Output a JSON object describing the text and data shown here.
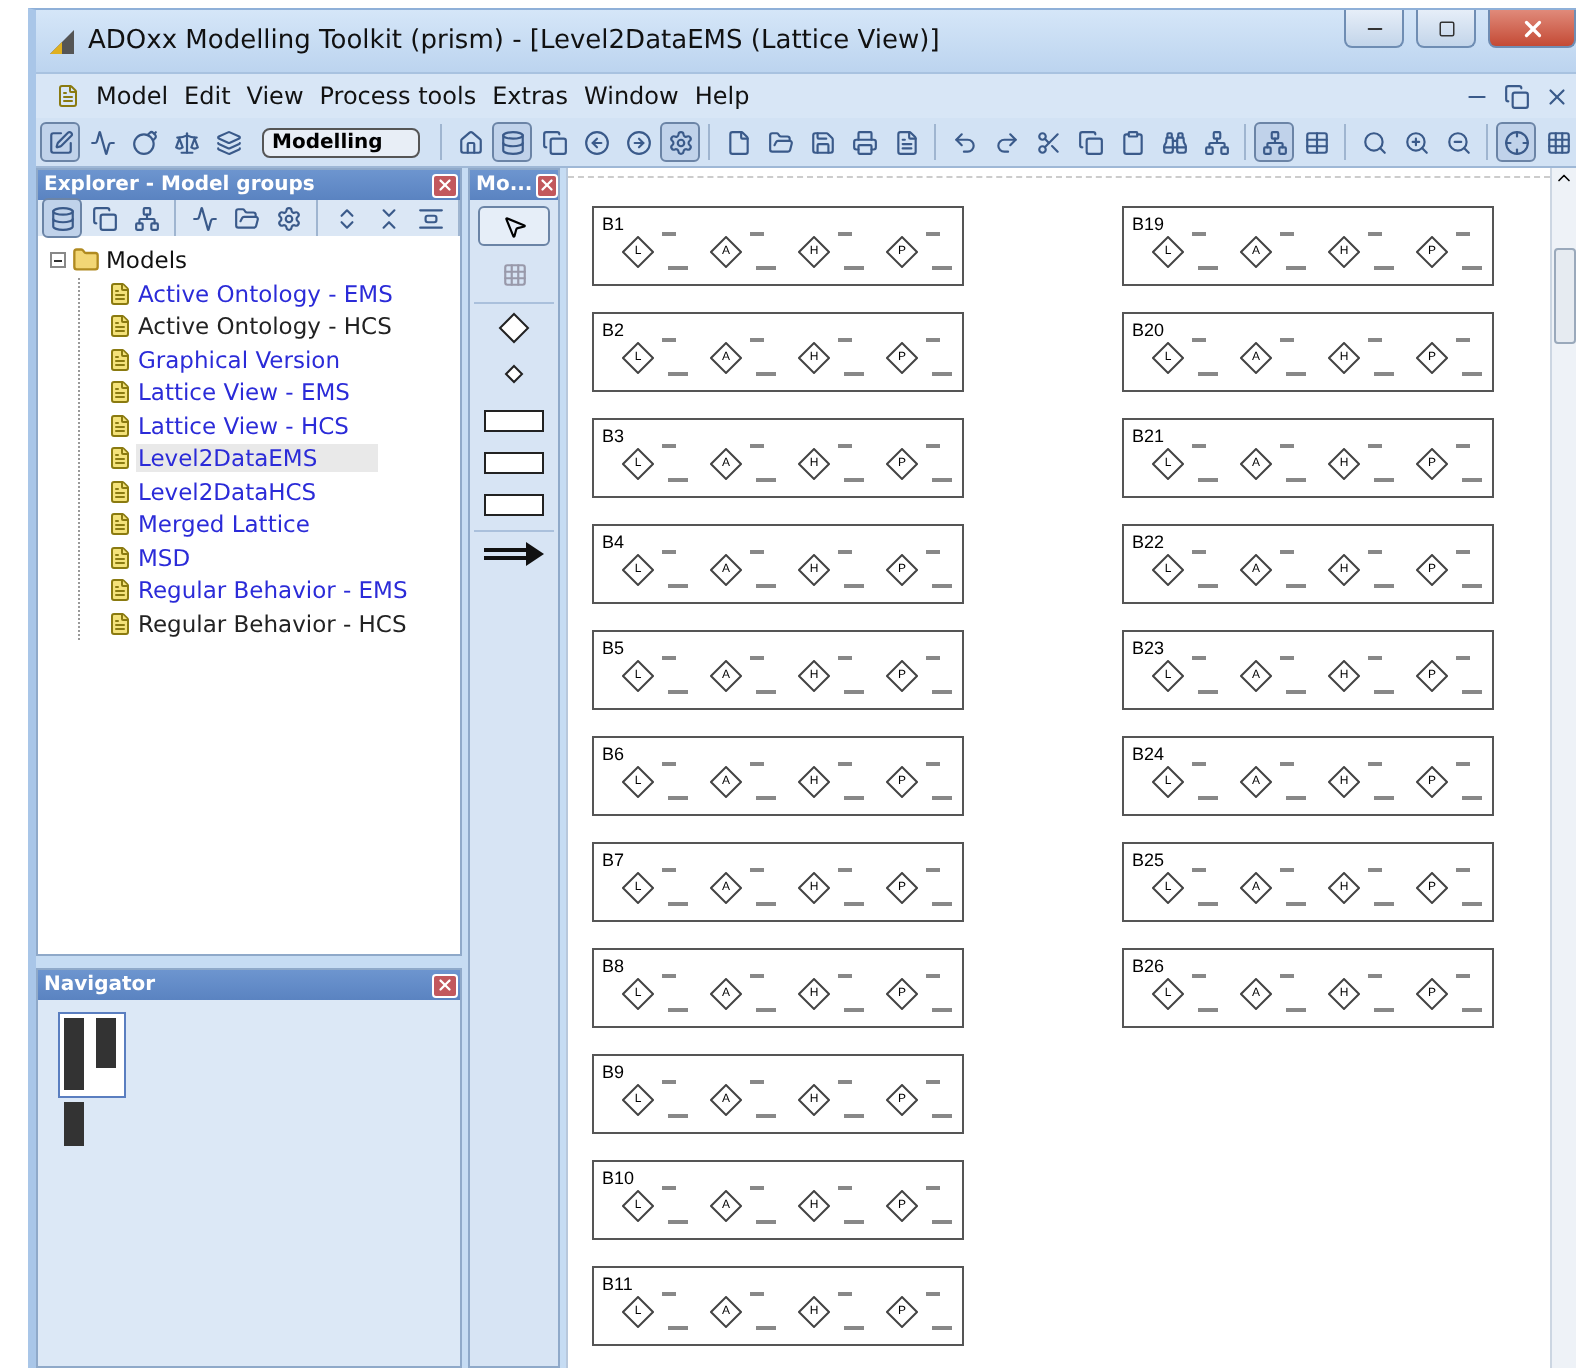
{
  "window": {
    "title": "ADOxx Modelling Toolkit (prism) - [Level2DataEMS (Lattice View)]"
  },
  "menu": [
    "Model",
    "Edit",
    "View",
    "Process tools",
    "Extras",
    "Window",
    "Help"
  ],
  "toolbar": {
    "mode": "Modelling"
  },
  "explorer": {
    "title": "Explorer - Model groups",
    "tree": {
      "label": "Models",
      "expanded": true,
      "children": [
        {
          "label": "Active Ontology - EMS",
          "color": "#2b2bd8",
          "selected": false
        },
        {
          "label": "Active Ontology - HCS",
          "color": "#222222",
          "selected": false
        },
        {
          "label": "Graphical Version",
          "color": "#2b2bd8",
          "selected": false
        },
        {
          "label": "Lattice View - EMS",
          "color": "#2b2bd8",
          "selected": false
        },
        {
          "label": "Lattice View - HCS",
          "color": "#2b2bd8",
          "selected": false
        },
        {
          "label": "Level2DataEMS",
          "color": "#2b2bd8",
          "selected": true
        },
        {
          "label": "Level2DataHCS",
          "color": "#2b2bd8",
          "selected": false
        },
        {
          "label": "Merged Lattice",
          "color": "#2b2bd8",
          "selected": false
        },
        {
          "label": "MSD",
          "color": "#2b2bd8",
          "selected": false
        },
        {
          "label": "Regular Behavior - EMS",
          "color": "#2b2bd8",
          "selected": false
        },
        {
          "label": "Regular Behavior - HCS",
          "color": "#222222",
          "selected": false
        }
      ]
    }
  },
  "navigator": {
    "title": "Navigator"
  },
  "palette": {
    "title": "Mo..."
  },
  "canvas": {
    "columns": [
      [
        {
          "label": "B1",
          "nodes": [
            "L",
            "A",
            "H",
            "P"
          ]
        },
        {
          "label": "B2",
          "nodes": [
            "L",
            "A",
            "H",
            "P"
          ]
        },
        {
          "label": "B3",
          "nodes": [
            "L",
            "A",
            "H",
            "P"
          ]
        },
        {
          "label": "B4",
          "nodes": [
            "L",
            "A",
            "H",
            "P"
          ]
        },
        {
          "label": "B5",
          "nodes": [
            "L",
            "A",
            "H",
            "P"
          ]
        },
        {
          "label": "B6",
          "nodes": [
            "L",
            "A",
            "H",
            "P"
          ]
        },
        {
          "label": "B7",
          "nodes": [
            "L",
            "A",
            "H",
            "P"
          ]
        },
        {
          "label": "B8",
          "nodes": [
            "L",
            "A",
            "H",
            "P"
          ]
        },
        {
          "label": "B9",
          "nodes": [
            "L",
            "A",
            "H",
            "P"
          ]
        },
        {
          "label": "B10",
          "nodes": [
            "L",
            "A",
            "H",
            "P"
          ]
        },
        {
          "label": "B11",
          "nodes": [
            "L",
            "A",
            "H",
            "P"
          ]
        }
      ],
      [
        {
          "label": "B19",
          "nodes": [
            "L",
            "A",
            "H",
            "P"
          ]
        },
        {
          "label": "B20",
          "nodes": [
            "L",
            "A",
            "H",
            "P"
          ]
        },
        {
          "label": "B21",
          "nodes": [
            "L",
            "A",
            "H",
            "P"
          ]
        },
        {
          "label": "B22",
          "nodes": [
            "L",
            "A",
            "H",
            "P"
          ]
        },
        {
          "label": "B23",
          "nodes": [
            "L",
            "A",
            "H",
            "P"
          ]
        },
        {
          "label": "B24",
          "nodes": [
            "L",
            "A",
            "H",
            "P"
          ]
        },
        {
          "label": "B25",
          "nodes": [
            "L",
            "A",
            "H",
            "P"
          ]
        },
        {
          "label": "B26",
          "nodes": [
            "L",
            "A",
            "H",
            "P"
          ]
        }
      ]
    ]
  }
}
